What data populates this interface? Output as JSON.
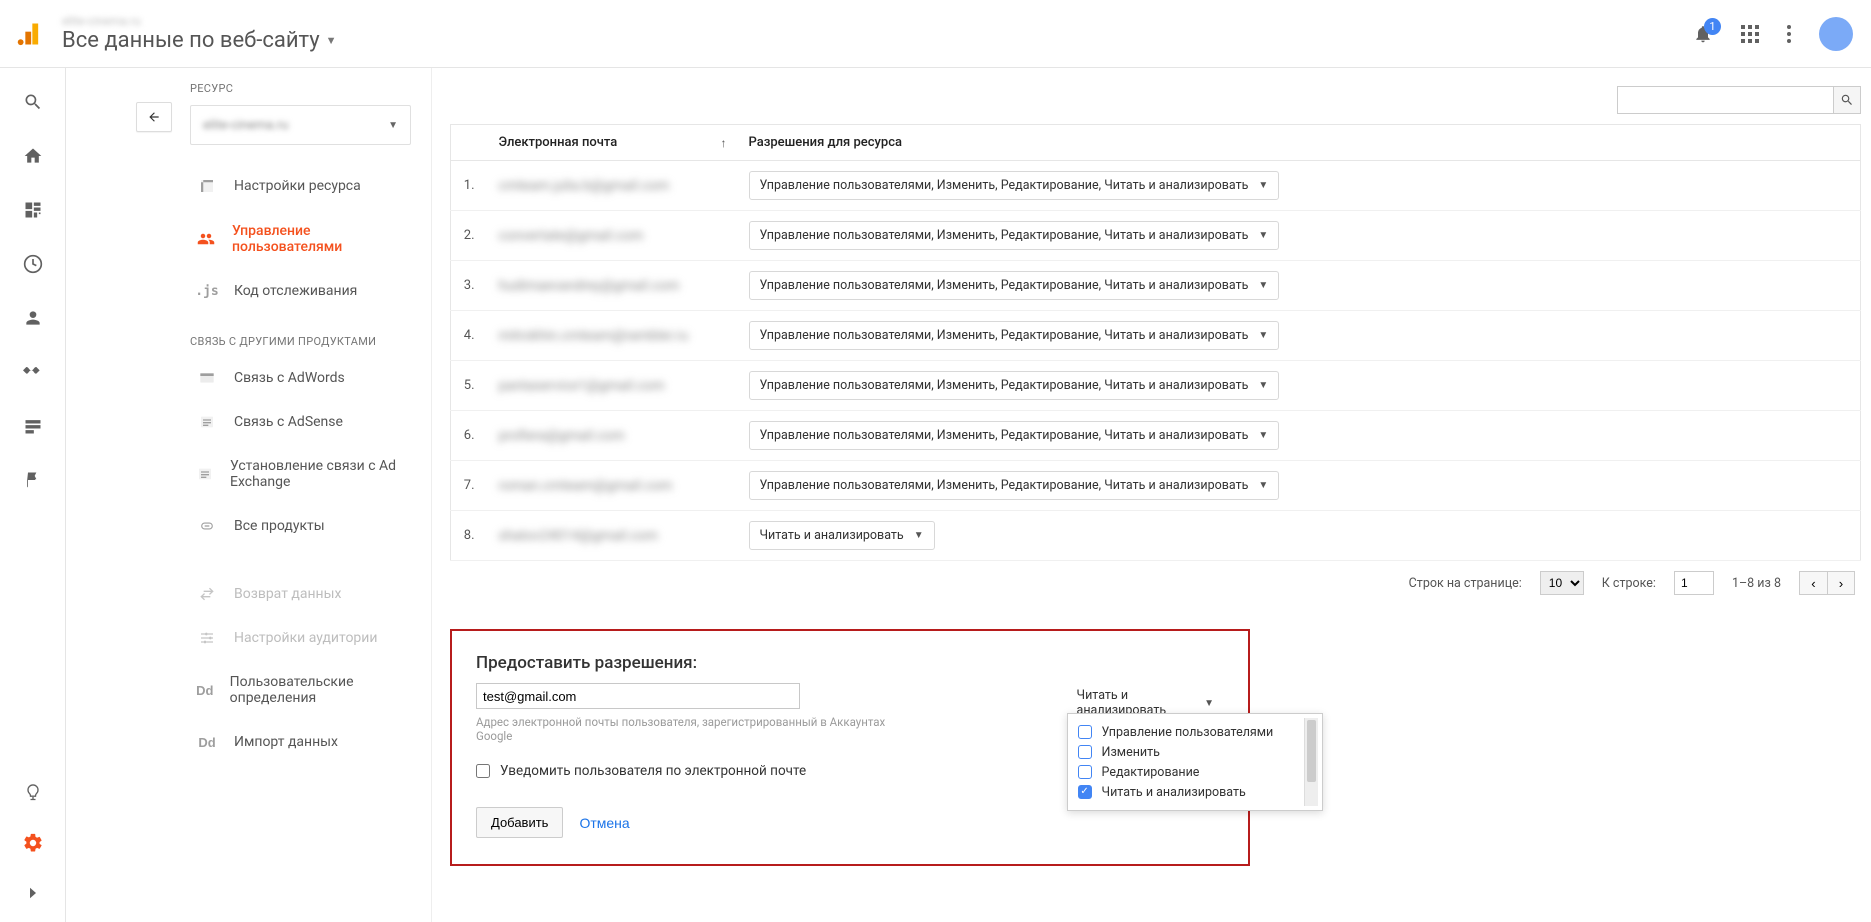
{
  "header": {
    "account_subtitle": "elite-cinema.ru",
    "view_title": "Все данные по веб-сайту",
    "notifications_count": "1"
  },
  "leftbar": {
    "items": [
      "search",
      "home",
      "customize",
      "clock",
      "user",
      "conversions",
      "behavior",
      "flag"
    ],
    "bottom": [
      "discover",
      "admin",
      "collapse"
    ]
  },
  "admin": {
    "category_label": "РЕСУРС",
    "resource_name": "elite-cinema.ru",
    "nav": {
      "settings": "Настройки ресурса",
      "users": "Управление пользователями",
      "tracking": "Код отслеживания"
    },
    "links_header": "СВЯЗЬ С ДРУГИМИ ПРОДУКТАМИ",
    "links": {
      "adwords": "Связь с AdWords",
      "adsense": "Связь с AdSense",
      "adexchange": "Установление связи с Ad Exchange",
      "all_products": "Все продукты"
    },
    "extra": {
      "postback": "Возврат данных",
      "audience": "Настройки аудитории",
      "custom_defs": "Пользовательские определения",
      "data_import": "Импорт данных"
    }
  },
  "table": {
    "col_email": "Электронная почта",
    "col_permissions": "Разрешения для ресурса",
    "sort_indicator": "↑",
    "rows": [
      {
        "n": "1.",
        "email": "cmteam.julia.b@gmail.com",
        "perm": "Управление пользователями, Изменить, Редактирование, Читать и анализировать"
      },
      {
        "n": "2.",
        "email": "convertate@gmail.com",
        "perm": "Управление пользователями, Изменить, Редактирование, Читать и анализировать"
      },
      {
        "n": "3.",
        "email": "hudimaevandrey@gmail.com",
        "perm": "Управление пользователями, Изменить, Редактирование, Читать и анализировать"
      },
      {
        "n": "4.",
        "email": "mitrokhin.cmteam@rambler.ru",
        "perm": "Управление пользователями, Изменить, Редактирование, Читать и анализировать"
      },
      {
        "n": "5.",
        "email": "pantaservice1@gmail.com",
        "perm": "Управление пользователями, Изменить, Редактирование, Читать и анализировать"
      },
      {
        "n": "6.",
        "email": "profiera@gmail.com",
        "perm": "Управление пользователями, Изменить, Редактирование, Читать и анализировать"
      },
      {
        "n": "7.",
        "email": "roman.cmteam@gmail.com",
        "perm": "Управление пользователями, Изменить, Редактирование, Читать и анализировать"
      },
      {
        "n": "8.",
        "email": "shatov24014@gmail.com",
        "perm": "Читать и анализировать"
      }
    ],
    "pager": {
      "rows_label": "Строк на странице:",
      "rows_value": "10",
      "goto_label": "К строке:",
      "goto_value": "1",
      "range": "1–8 из 8"
    }
  },
  "grant": {
    "title": "Предоставить разрешения:",
    "email_value": "test@gmail.com",
    "hint": "Адрес электронной почты пользователя, зарегистрированный в Аккаунтах Google",
    "notify_label": "Уведомить пользователя по электронной почте",
    "add": "Добавить",
    "cancel": "Отмена",
    "selected_perm": "Читать и анализировать",
    "options": {
      "manage": "Управление пользователями",
      "edit": "Изменить",
      "collab": "Редактирование",
      "read": "Читать и анализировать"
    }
  }
}
